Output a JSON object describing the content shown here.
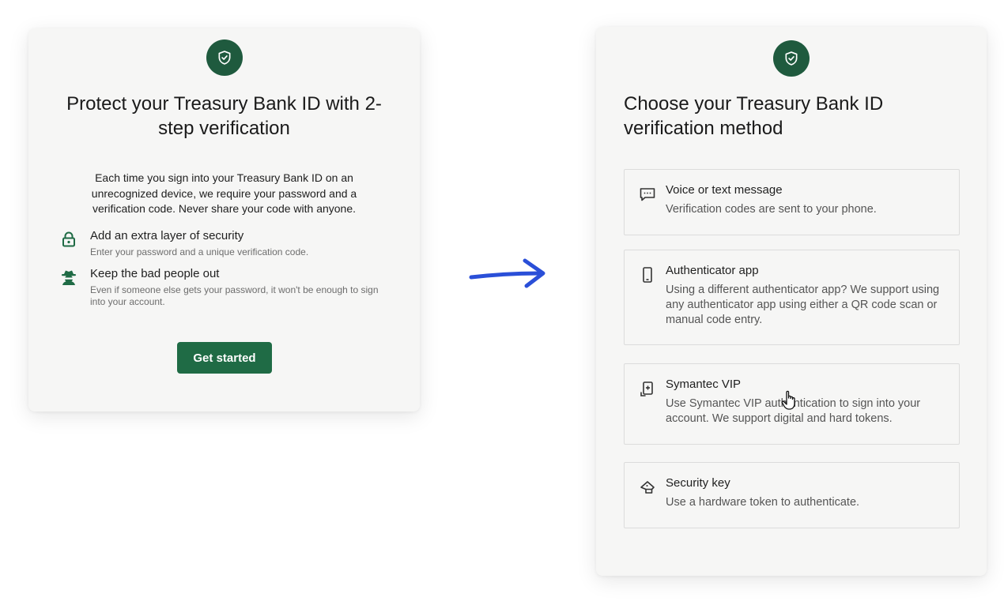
{
  "left_card": {
    "title": "Protect your Treasury Bank ID with 2-step verification",
    "description": "Each time you sign into your Treasury Bank ID on an unrecognized device, we require your password and a verification code. Never share your code with anyone.",
    "features": [
      {
        "icon": "lock-icon",
        "title": "Add an extra layer of security",
        "description": "Enter your password and a unique verification code."
      },
      {
        "icon": "spy-icon",
        "title": "Keep the bad people out",
        "description": "Even if someone else gets your password, it won't be enough to sign into your account."
      }
    ],
    "button_label": "Get started"
  },
  "right_card": {
    "title": "Choose your Treasury Bank ID verification method",
    "methods": [
      {
        "icon": "message-icon",
        "title": "Voice or text message",
        "description": "Verification codes are sent to your phone."
      },
      {
        "icon": "phone-icon",
        "title": "Authenticator app",
        "description": "Using a different authenticator app? We support using any authenticator app using either a QR code scan or manual code entry."
      },
      {
        "icon": "token-device-icon",
        "title": "Symantec VIP",
        "description": "Use Symantec VIP authentication to sign into your account. We support digital and hard tokens."
      },
      {
        "icon": "security-key-icon",
        "title": "Security key",
        "description": "Use a hardware token to authenticate."
      }
    ]
  },
  "colors": {
    "brand_green": "#1f5a3e",
    "button_green": "#1f6b45",
    "arrow_blue": "#2a4fd8"
  }
}
